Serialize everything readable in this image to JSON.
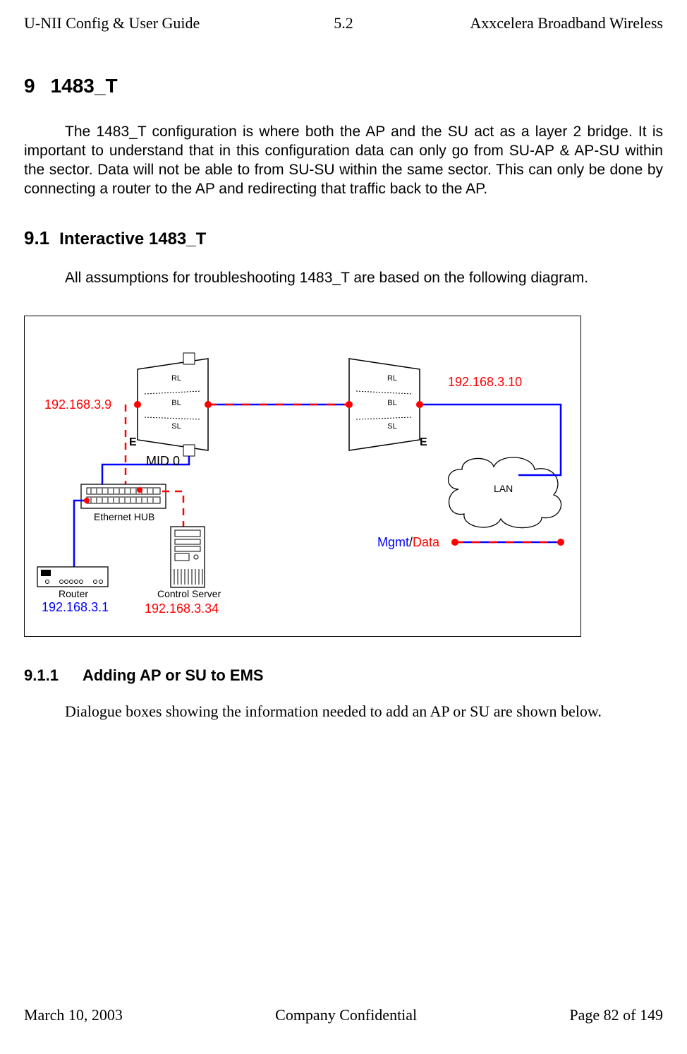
{
  "header": {
    "left": "U-NII Config & User Guide",
    "center": "5.2",
    "right": "Axxcelera Broadband Wireless"
  },
  "h1": {
    "num": "9",
    "title": "1483_T"
  },
  "p1": "The 1483_T configuration is where both the AP and the SU act as a layer 2 bridge. It is important to understand that in this configuration data can only go from SU-AP & AP-SU within the sector. Data will not be able to from SU-SU within the same sector. This can only be done by connecting a router to the AP and redirecting that traffic back to the AP.",
  "h2": {
    "num": "9.1",
    "title": "Interactive 1483_T"
  },
  "p2": "All assumptions for troubleshooting 1483_T are based on the following diagram.",
  "diagram": {
    "ip": {
      "left_node": "192.168.3.9",
      "right_node": "192.168.3.10",
      "router": "192.168.3.1",
      "control_server": "192.168.3.34"
    },
    "labels": {
      "mid0": "MID 0",
      "E_left": "E",
      "E_right": "E",
      "lan": "LAN",
      "ethernet_hub": "Ethernet HUB",
      "router": "Router",
      "control_server": "Control Server",
      "mgmt": "Mgmt",
      "data": "Data",
      "slash": "/"
    },
    "node_layers": {
      "rl": "RL",
      "bl": "BL",
      "sl": "SL"
    }
  },
  "h3": {
    "num": "9.1.1",
    "title": "Adding AP or SU to EMS"
  },
  "p3": "Dialogue boxes showing the information needed to add an AP or SU are shown below.",
  "footer": {
    "left": "March 10, 2003",
    "center": "Company Confidential",
    "right": "Page 82 of 149"
  }
}
